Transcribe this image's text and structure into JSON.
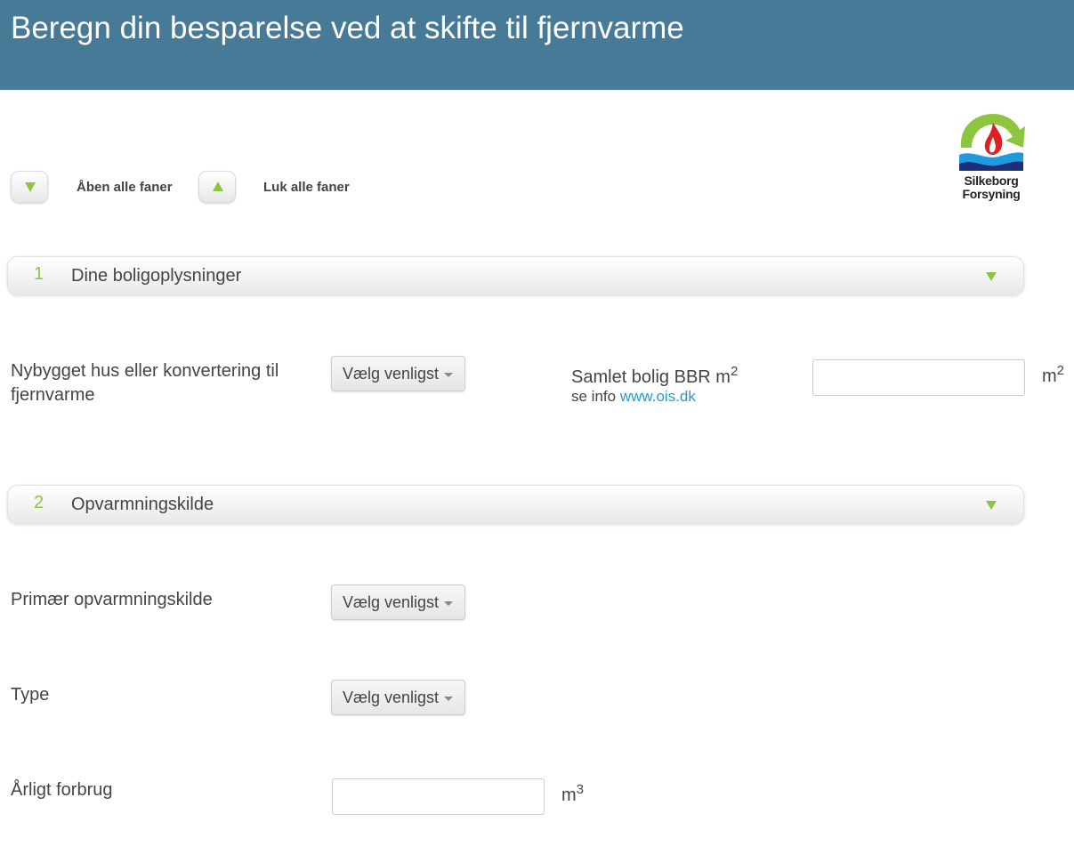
{
  "header": {
    "title": "Beregn din besparelse ved at skifte til fjernvarme"
  },
  "toolbar": {
    "open_all_label": "Åben alle faner",
    "close_all_label": "Luk alle faner"
  },
  "logo": {
    "line1": "Silkeborg",
    "line2": "Forsyning"
  },
  "sections": [
    {
      "number": "1",
      "title": "Dine boligoplysninger"
    },
    {
      "number": "2",
      "title": "Opvarmningskilde"
    }
  ],
  "section1": {
    "house_type_label": "Nybygget hus eller konvertering til fjernvarme",
    "house_type_select": "Vælg venligst",
    "area_label": "Samlet bolig BBR m",
    "area_label_sup": "2",
    "area_info_prefix": "se info",
    "area_info_link": "www.ois.dk",
    "area_value": "",
    "area_unit": "m",
    "area_unit_sup": "2"
  },
  "section2": {
    "primary_source_label": "Primær opvarmningskilde",
    "primary_source_select": "Vælg venligst",
    "type_label": "Type",
    "type_select": "Vælg venligst",
    "annual_usage_label": "Årligt forbrug",
    "annual_usage_value": "",
    "annual_usage_unit": "m",
    "annual_usage_unit_sup": "3"
  },
  "colors": {
    "header_bg": "#467a96",
    "accent_green": "#8cc63f",
    "link_blue": "#2a9bc8"
  }
}
